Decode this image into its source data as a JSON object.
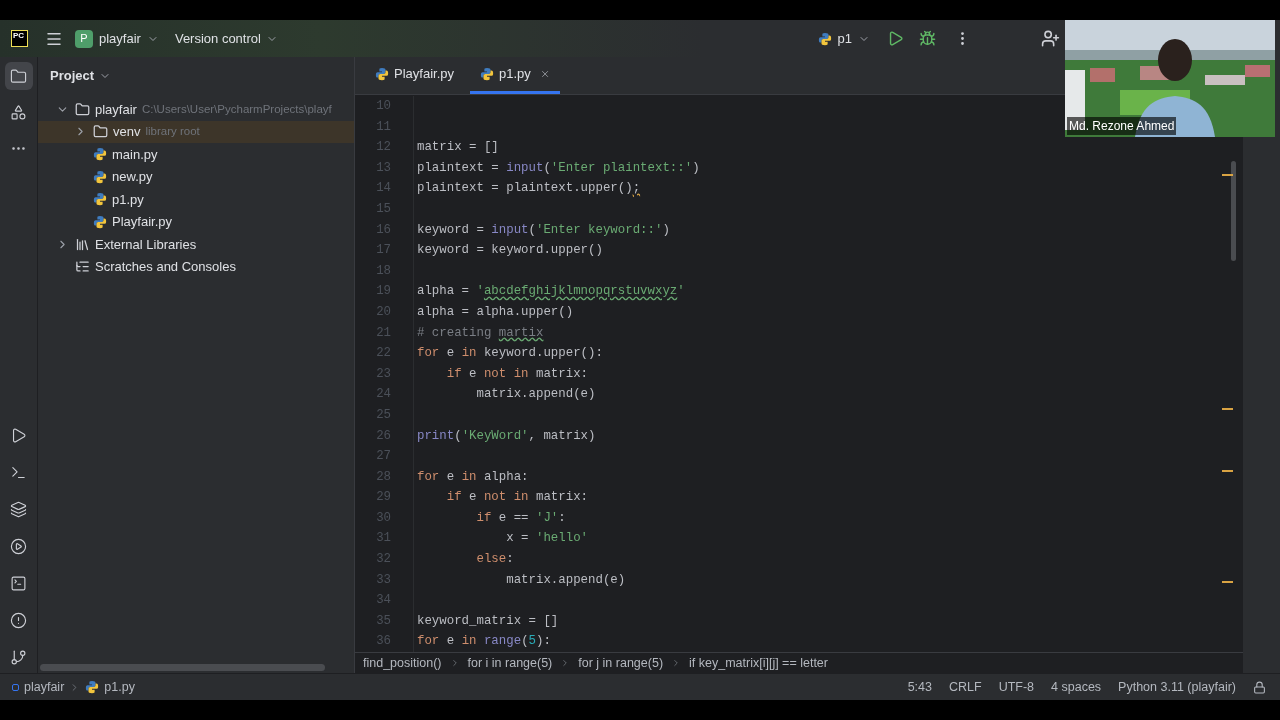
{
  "title_bar": {
    "logo": "PC",
    "project_badge": "P",
    "project": "playfair",
    "vcs": "Version control",
    "run_config": "p1"
  },
  "tool_strip": {
    "top": [
      {
        "kind": "folder",
        "selected": true
      },
      {
        "kind": "structure",
        "selected": false
      },
      {
        "kind": "more",
        "selected": false
      }
    ],
    "bottom": [
      {
        "kind": "run",
        "selected": false
      },
      {
        "kind": "console",
        "selected": false
      },
      {
        "kind": "layers",
        "selected": false
      },
      {
        "kind": "services",
        "selected": false
      },
      {
        "kind": "terminal",
        "selected": false
      },
      {
        "kind": "problems",
        "selected": false
      },
      {
        "kind": "git",
        "selected": false
      }
    ]
  },
  "project_panel": {
    "title": "Project",
    "tree": [
      {
        "kind": "folder",
        "name": "playfair",
        "hint": "C:\\Users\\User\\PycharmProjects\\playf",
        "expanded": true,
        "selected": false,
        "children": [
          {
            "kind": "folder",
            "name": "venv",
            "hint": "library root",
            "expanded": false,
            "selected": true
          },
          {
            "kind": "python",
            "name": "main.py",
            "selected": false
          },
          {
            "kind": "python",
            "name": "new.py",
            "selected": false
          },
          {
            "kind": "python",
            "name": "p1.py",
            "selected": false
          },
          {
            "kind": "python",
            "name": "Playfair.py",
            "selected": false
          }
        ]
      },
      {
        "kind": "library",
        "name": "External Libraries",
        "expanded": false,
        "selected": false
      },
      {
        "kind": "scratches",
        "name": "Scratches and Consoles",
        "selected": false
      }
    ]
  },
  "tabs": [
    {
      "label": "Playfair.py",
      "selected": false
    },
    {
      "label": "p1.py",
      "selected": true
    }
  ],
  "editor": {
    "lines": [
      {
        "number": "10"
      },
      {
        "number": "11"
      },
      {
        "number": "12",
        "tokens": [
          {
            "kind": "plain",
            "text": "matrix = []"
          }
        ]
      },
      {
        "number": "13",
        "tokens": [
          {
            "kind": "plain",
            "text": "plaintext = "
          },
          {
            "kind": "builtin",
            "text": "input"
          },
          {
            "kind": "plain",
            "text": "("
          },
          {
            "kind": "string",
            "text": "'Enter plaintext::'"
          },
          {
            "kind": "plain",
            "text": ")"
          }
        ]
      },
      {
        "number": "14",
        "tokens": [
          {
            "kind": "plain",
            "text": "plaintext = plaintext.upper()"
          },
          {
            "kind": "warning",
            "text": ";"
          }
        ]
      },
      {
        "number": "15"
      },
      {
        "number": "16",
        "tokens": [
          {
            "kind": "plain",
            "text": "keyword = "
          },
          {
            "kind": "builtin",
            "text": "input"
          },
          {
            "kind": "plain",
            "text": "("
          },
          {
            "kind": "string",
            "text": "'Enter keyword::'"
          },
          {
            "kind": "plain",
            "text": ")"
          }
        ]
      },
      {
        "number": "17",
        "tokens": [
          {
            "kind": "plain",
            "text": "keyword = keyword.upper()"
          }
        ]
      },
      {
        "number": "18"
      },
      {
        "number": "19",
        "tokens": [
          {
            "kind": "plain",
            "text": "alpha = "
          },
          {
            "kind": "string",
            "text": "'"
          },
          {
            "kind": "typo_string",
            "text": "abcdefghijklmnopqrstuvwxyz"
          },
          {
            "kind": "string",
            "text": "'"
          }
        ]
      },
      {
        "number": "20",
        "tokens": [
          {
            "kind": "plain",
            "text": "alpha = alpha.upper()"
          }
        ]
      },
      {
        "number": "21",
        "tokens": [
          {
            "kind": "comment",
            "text": "# creating "
          },
          {
            "kind": "typo_comment",
            "text": "martix"
          }
        ]
      },
      {
        "number": "22",
        "tokens": [
          {
            "kind": "keyword",
            "text": "for"
          },
          {
            "kind": "plain",
            "text": " e "
          },
          {
            "kind": "keyword",
            "text": "in"
          },
          {
            "kind": "plain",
            "text": " keyword.upper():"
          }
        ]
      },
      {
        "number": "23",
        "tokens": [
          {
            "kind": "keyword",
            "text": "    if"
          },
          {
            "kind": "plain",
            "text": " e "
          },
          {
            "kind": "keyword",
            "text": "not in"
          },
          {
            "kind": "plain",
            "text": " matrix:"
          }
        ]
      },
      {
        "number": "24",
        "tokens": [
          {
            "kind": "plain",
            "text": "        matrix.append(e)"
          }
        ]
      },
      {
        "number": "25"
      },
      {
        "number": "26",
        "tokens": [
          {
            "kind": "builtin",
            "text": "print"
          },
          {
            "kind": "plain",
            "text": "("
          },
          {
            "kind": "string",
            "text": "'KeyWord'"
          },
          {
            "kind": "plain",
            "text": ", matrix)"
          }
        ]
      },
      {
        "number": "27"
      },
      {
        "number": "28",
        "tokens": [
          {
            "kind": "keyword",
            "text": "for"
          },
          {
            "kind": "plain",
            "text": " e "
          },
          {
            "kind": "keyword",
            "text": "in"
          },
          {
            "kind": "plain",
            "text": " alpha:"
          }
        ]
      },
      {
        "number": "29",
        "tokens": [
          {
            "kind": "keyword",
            "text": "    if"
          },
          {
            "kind": "plain",
            "text": " e "
          },
          {
            "kind": "keyword",
            "text": "not in"
          },
          {
            "kind": "plain",
            "text": " matrix:"
          }
        ]
      },
      {
        "number": "30",
        "tokens": [
          {
            "kind": "keyword",
            "text": "        if"
          },
          {
            "kind": "plain",
            "text": " e == "
          },
          {
            "kind": "string",
            "text": "'J'"
          },
          {
            "kind": "plain",
            "text": ":"
          }
        ]
      },
      {
        "number": "31",
        "tokens": [
          {
            "kind": "plain",
            "text": "            x = "
          },
          {
            "kind": "string",
            "text": "'hello'"
          }
        ]
      },
      {
        "number": "32",
        "tokens": [
          {
            "kind": "keyword",
            "text": "        else"
          },
          {
            "kind": "plain",
            "text": ":"
          }
        ]
      },
      {
        "number": "33",
        "tokens": [
          {
            "kind": "plain",
            "text": "            matrix.append(e)"
          }
        ]
      },
      {
        "number": "34"
      },
      {
        "number": "35",
        "tokens": [
          {
            "kind": "plain",
            "text": "keyword_matrix = []"
          }
        ]
      },
      {
        "number": "36",
        "tokens": [
          {
            "kind": "keyword",
            "text": "for"
          },
          {
            "kind": "plain",
            "text": " e "
          },
          {
            "kind": "keyword",
            "text": "in"
          },
          {
            "kind": "builtin",
            "text": " range"
          },
          {
            "kind": "plain",
            "text": "("
          },
          {
            "kind": "number",
            "text": "5"
          },
          {
            "kind": "plain",
            "text": "):"
          }
        ]
      }
    ]
  },
  "breadcrumbs": [
    "find_position()",
    "for i in range(5)",
    "for j in range(5)",
    "if key_matrix[i][j] == letter"
  ],
  "status_bar": {
    "path": [
      "playfair",
      "p1.py"
    ],
    "items": [
      "5:43",
      "CRLF",
      "UTF-8",
      "4 spaces",
      "Python 3.11 (playfair)"
    ]
  },
  "webcam": {
    "kind": "picture",
    "name": "Md. Rezone Ahmed"
  }
}
